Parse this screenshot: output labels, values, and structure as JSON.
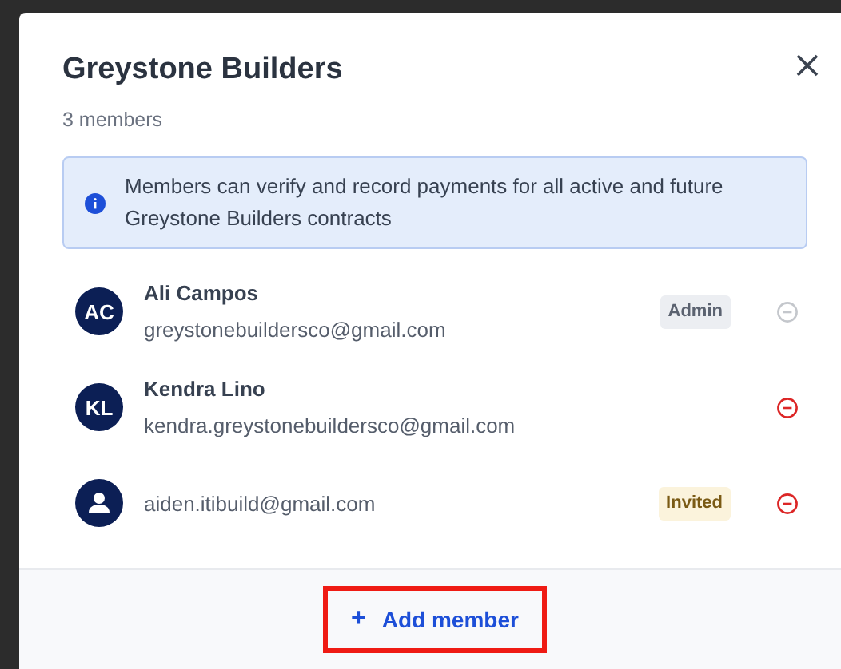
{
  "dialog": {
    "title": "Greystone Builders",
    "subtitle": "3 members"
  },
  "notice": {
    "text": "Members can verify and record payments for all active and future Greystone Builders contracts"
  },
  "members": [
    {
      "avatar": {
        "kind": "initials",
        "text": "AC"
      },
      "name": "Ali Campos",
      "email": "greystonebuildersco@gmail.com",
      "badge": {
        "kind": "admin",
        "text": "Admin"
      },
      "remove_disabled": true
    },
    {
      "avatar": {
        "kind": "initials",
        "text": "KL"
      },
      "name": "Kendra Lino",
      "email": "kendra.greystonebuildersco@gmail.com",
      "remove_disabled": false
    },
    {
      "avatar": {
        "kind": "person"
      },
      "email": "aiden.itibuild@gmail.com",
      "badge": {
        "kind": "invited",
        "text": "Invited"
      },
      "remove_disabled": false
    }
  ],
  "footer": {
    "add_button": {
      "icon": "+",
      "label": "Add member",
      "highlighted": true
    }
  }
}
